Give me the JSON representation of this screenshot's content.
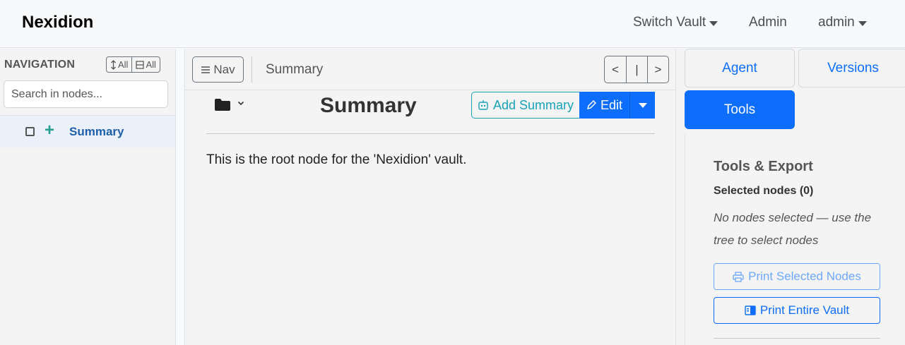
{
  "app": {
    "brand": "Nexidion",
    "nav": {
      "switch_vault": "Switch Vault",
      "admin": "Admin",
      "user": "admin"
    }
  },
  "sidebar": {
    "heading": "NAVIGATION",
    "expand_all": "All",
    "collapse_all": "All",
    "search_placeholder": "Search in nodes...",
    "tree": [
      {
        "label": "Summary",
        "checked": false
      }
    ]
  },
  "toolbar": {
    "nav_label": "Nav",
    "breadcrumb": "Summary",
    "prev": "<",
    "mid": "|",
    "next": ">"
  },
  "node": {
    "title": "Summary",
    "add_summary_label": "Add Summary",
    "edit_label": "Edit",
    "content": "This is the root node for the 'Nexidion' vault."
  },
  "right_panel": {
    "tabs": {
      "agent": "Agent",
      "versions": "Versions",
      "tools": "Tools"
    },
    "active_tab": "Tools",
    "tools": {
      "heading": "Tools & Export",
      "selected_heading": "Selected nodes (0)",
      "no_selection": "No nodes selected — use the tree to select nodes",
      "print_selected": "Print Selected Nodes",
      "print_vault": "Print Entire Vault"
    }
  },
  "colors": {
    "primary": "#0d6efd",
    "info": "#17a2b8",
    "tree_plus": "#2a9d8f",
    "tree_label": "#1f5fa8"
  },
  "icons": [
    "sort-icon",
    "collapse-icon",
    "checkbox-icon",
    "plus-icon",
    "menu-icon",
    "folder-icon",
    "chevron-down-icon",
    "robot-icon",
    "pencil-icon",
    "printer-icon",
    "vault-icon"
  ]
}
